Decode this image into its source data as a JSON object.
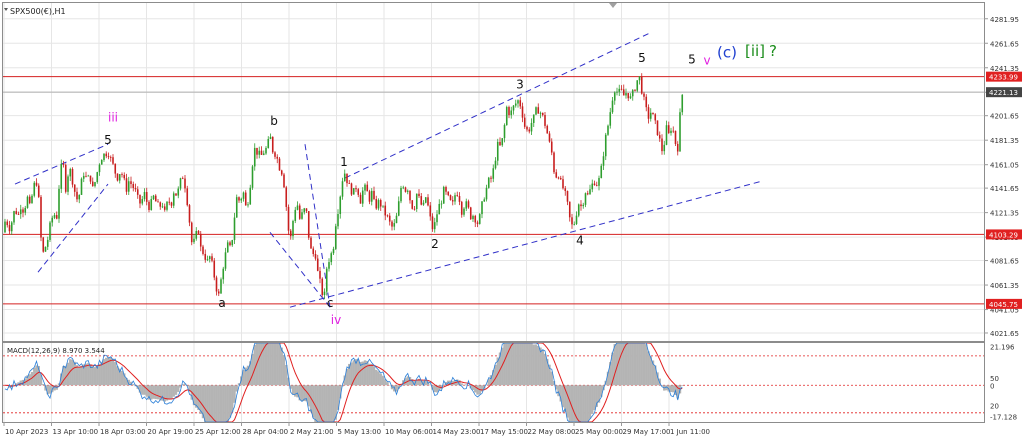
{
  "colors": {
    "up": "#2e9e2e",
    "down": "#c81e1e",
    "grid": "#e6e6e6",
    "hline": "#d42020",
    "channel": "#3030c8",
    "black": "#111111",
    "magenta": "#e020e0",
    "blue": "#2040d0",
    "green": "#1a8c1a",
    "axis": "#9a9a9a",
    "macd_fill": "#b4b4b4",
    "macd_signal": "#e02020",
    "macd_line": "#2a7fd8",
    "macd_level": "#e02020",
    "price_tag_red": "#e02020",
    "price_tag_dark": "#444444"
  },
  "chart_data": {
    "type": "candlestick",
    "title": "SPX500(€),H1",
    "ylim": [
      4015,
      4295
    ],
    "grid": true,
    "y_ticks": [
      "4281.95",
      "4261.65",
      "4241.35",
      "4221.05",
      "4201.65",
      "4181.35",
      "4161.05",
      "4141.65",
      "4121.35",
      "4101.05",
      "4081.65",
      "4061.35",
      "4041.05",
      "4021.65"
    ],
    "x_ticks": [
      "10 Apr 2023",
      "13 Apr 10:00",
      "18 Apr 03:00",
      "20 Apr 19:00",
      "25 Apr 12:00",
      "28 Apr 04:00",
      "2 May 21:00",
      "5 May 13:00",
      "10 May 06:00",
      "14 May 23:00",
      "17 May 15:00",
      "22 May 08:00",
      "25 May 00:00",
      "29 May 17:00",
      "1 Jun 11:00"
    ],
    "price_levels": [
      {
        "value": 4233.99,
        "label": "4233.99",
        "style": "red"
      },
      {
        "value": 4221.13,
        "label": "4221.13",
        "style": "current"
      },
      {
        "value": 4103.29,
        "label": "4103.29",
        "style": "red"
      },
      {
        "value": 4045.75,
        "label": "4045.75",
        "style": "red"
      }
    ],
    "path": [
      [
        0,
        4105
      ],
      [
        3,
        4112
      ],
      [
        6,
        4115
      ],
      [
        10,
        4108
      ],
      [
        13,
        4118
      ],
      [
        15,
        4125
      ],
      [
        18,
        4118
      ],
      [
        21,
        4128
      ],
      [
        24,
        4122
      ],
      [
        27,
        4135
      ],
      [
        30,
        4125
      ],
      [
        33,
        4140
      ],
      [
        36,
        4150
      ],
      [
        39,
        4130
      ],
      [
        42,
        4085
      ],
      [
        45,
        4092
      ],
      [
        48,
        4100
      ],
      [
        51,
        4115
      ],
      [
        54,
        4120
      ],
      [
        57,
        4118
      ],
      [
        60,
        4155
      ],
      [
        63,
        4163
      ],
      [
        66,
        4140
      ],
      [
        69,
        4160
      ],
      [
        72,
        4150
      ],
      [
        75,
        4138
      ],
      [
        78,
        4130
      ],
      [
        81,
        4145
      ],
      [
        84,
        4155
      ],
      [
        87,
        4148
      ],
      [
        90,
        4152
      ],
      [
        93,
        4140
      ],
      [
        96,
        4150
      ],
      [
        99,
        4162
      ],
      [
        102,
        4168
      ],
      [
        105,
        4170
      ],
      [
        108,
        4172
      ],
      [
        111,
        4165
      ],
      [
        114,
        4158
      ],
      [
        117,
        4150
      ],
      [
        120,
        4155
      ],
      [
        123,
        4152
      ],
      [
        126,
        4140
      ],
      [
        129,
        4148
      ],
      [
        132,
        4144
      ],
      [
        135,
        4140
      ],
      [
        138,
        4132
      ],
      [
        141,
        4128
      ],
      [
        144,
        4138
      ],
      [
        147,
        4130
      ],
      [
        150,
        4125
      ],
      [
        153,
        4135
      ],
      [
        156,
        4130
      ],
      [
        159,
        4125
      ],
      [
        162,
        4130
      ],
      [
        165,
        4120
      ],
      [
        168,
        4132
      ],
      [
        171,
        4128
      ],
      [
        174,
        4140
      ],
      [
        177,
        4135
      ],
      [
        180,
        4146
      ],
      [
        183,
        4152
      ],
      [
        186,
        4140
      ],
      [
        189,
        4118
      ],
      [
        192,
        4095
      ],
      [
        195,
        4098
      ],
      [
        198,
        4110
      ],
      [
        201,
        4090
      ],
      [
        204,
        4088
      ],
      [
        207,
        4080
      ],
      [
        210,
        4085
      ],
      [
        213,
        4075
      ],
      [
        216,
        4060
      ],
      [
        219,
        4052
      ],
      [
        222,
        4072
      ],
      [
        225,
        4085
      ],
      [
        228,
        4095
      ],
      [
        231,
        4090
      ],
      [
        234,
        4115
      ],
      [
        237,
        4135
      ],
      [
        240,
        4130
      ],
      [
        243,
        4140
      ],
      [
        246,
        4125
      ],
      [
        249,
        4135
      ],
      [
        252,
        4160
      ],
      [
        255,
        4175
      ],
      [
        258,
        4170
      ],
      [
        261,
        4168
      ],
      [
        264,
        4172
      ],
      [
        267,
        4175
      ],
      [
        270,
        4185
      ],
      [
        273,
        4172
      ],
      [
        276,
        4170
      ],
      [
        279,
        4160
      ],
      [
        282,
        4155
      ],
      [
        285,
        4140
      ],
      [
        288,
        4108
      ],
      [
        291,
        4100
      ],
      [
        294,
        4122
      ],
      [
        297,
        4130
      ],
      [
        300,
        4115
      ],
      [
        303,
        4122
      ],
      [
        306,
        4125
      ],
      [
        309,
        4100
      ],
      [
        312,
        4085
      ],
      [
        315,
        4090
      ],
      [
        318,
        4070
      ],
      [
        321,
        4060
      ],
      [
        324,
        4048
      ],
      [
        327,
        4078
      ],
      [
        330,
        4085
      ],
      [
        333,
        4090
      ],
      [
        336,
        4115
      ],
      [
        339,
        4128
      ],
      [
        342,
        4148
      ],
      [
        345,
        4155
      ],
      [
        348,
        4145
      ],
      [
        351,
        4140
      ],
      [
        354,
        4138
      ],
      [
        357,
        4145
      ],
      [
        360,
        4130
      ],
      [
        363,
        4140
      ],
      [
        366,
        4142
      ],
      [
        369,
        4132
      ],
      [
        372,
        4138
      ],
      [
        375,
        4125
      ],
      [
        378,
        4130
      ],
      [
        381,
        4128
      ],
      [
        384,
        4122
      ],
      [
        387,
        4118
      ],
      [
        390,
        4112
      ],
      [
        393,
        4108
      ],
      [
        396,
        4115
      ],
      [
        399,
        4130
      ],
      [
        402,
        4148
      ],
      [
        405,
        4140
      ],
      [
        408,
        4142
      ],
      [
        411,
        4128
      ],
      [
        414,
        4125
      ],
      [
        417,
        4138
      ],
      [
        420,
        4130
      ],
      [
        423,
        4125
      ],
      [
        426,
        4135
      ],
      [
        429,
        4122
      ],
      [
        432,
        4108
      ],
      [
        435,
        4112
      ],
      [
        438,
        4125
      ],
      [
        441,
        4130
      ],
      [
        444,
        4140
      ],
      [
        447,
        4135
      ],
      [
        450,
        4130
      ],
      [
        453,
        4128
      ],
      [
        456,
        4140
      ],
      [
        459,
        4135
      ],
      [
        462,
        4122
      ],
      [
        465,
        4130
      ],
      [
        468,
        4125
      ],
      [
        471,
        4118
      ],
      [
        474,
        4120
      ],
      [
        477,
        4112
      ],
      [
        480,
        4118
      ],
      [
        483,
        4132
      ],
      [
        486,
        4140
      ],
      [
        489,
        4148
      ],
      [
        492,
        4150
      ],
      [
        495,
        4165
      ],
      [
        498,
        4178
      ],
      [
        501,
        4175
      ],
      [
        504,
        4190
      ],
      [
        507,
        4210
      ],
      [
        510,
        4202
      ],
      [
        513,
        4208
      ],
      [
        516,
        4212
      ],
      [
        519,
        4215
      ],
      [
        522,
        4205
      ],
      [
        525,
        4192
      ],
      [
        528,
        4188
      ],
      [
        531,
        4195
      ],
      [
        534,
        4200
      ],
      [
        537,
        4208
      ],
      [
        540,
        4205
      ],
      [
        543,
        4200
      ],
      [
        546,
        4192
      ],
      [
        549,
        4180
      ],
      [
        552,
        4170
      ],
      [
        555,
        4150
      ],
      [
        558,
        4155
      ],
      [
        561,
        4145
      ],
      [
        564,
        4140
      ],
      [
        567,
        4130
      ],
      [
        570,
        4115
      ],
      [
        573,
        4108
      ],
      [
        576,
        4120
      ],
      [
        579,
        4130
      ],
      [
        582,
        4125
      ],
      [
        585,
        4140
      ],
      [
        588,
        4135
      ],
      [
        591,
        4142
      ],
      [
        594,
        4148
      ],
      [
        597,
        4145
      ],
      [
        600,
        4150
      ],
      [
        603,
        4168
      ],
      [
        606,
        4185
      ],
      [
        609,
        4198
      ],
      [
        612,
        4215
      ],
      [
        615,
        4225
      ],
      [
        618,
        4220
      ],
      [
        621,
        4222
      ],
      [
        624,
        4218
      ],
      [
        627,
        4222
      ],
      [
        630,
        4215
      ],
      [
        633,
        4220
      ],
      [
        636,
        4228
      ],
      [
        639,
        4235
      ],
      [
        642,
        4222
      ],
      [
        645,
        4210
      ],
      [
        648,
        4200
      ],
      [
        651,
        4205
      ],
      [
        654,
        4198
      ],
      [
        657,
        4190
      ],
      [
        660,
        4180
      ],
      [
        663,
        4170
      ],
      [
        666,
        4192
      ],
      [
        669,
        4185
      ],
      [
        672,
        4195
      ],
      [
        675,
        4180
      ],
      [
        678,
        4175
      ],
      [
        681,
        4215
      ],
      [
        684,
        4225
      ]
    ],
    "waves": [
      {
        "text": "iii",
        "color": "magenta",
        "x": 113,
        "y": 4197
      },
      {
        "text": "5",
        "color": "black",
        "x": 108,
        "y": 4178
      },
      {
        "text": "a",
        "color": "black",
        "x": 222,
        "y": 4043
      },
      {
        "text": "b",
        "color": "black",
        "x": 274,
        "y": 4194
      },
      {
        "text": "c",
        "color": "black",
        "x": 330,
        "y": 4043
      },
      {
        "text": "iv",
        "color": "magenta",
        "x": 336,
        "y": 4029
      },
      {
        "text": "1",
        "color": "black",
        "x": 344,
        "y": 4160
      },
      {
        "text": "2",
        "color": "black",
        "x": 435,
        "y": 4092
      },
      {
        "text": "3",
        "color": "black",
        "x": 520,
        "y": 4224
      },
      {
        "text": "4",
        "color": "black",
        "x": 580,
        "y": 4095
      },
      {
        "text": "5",
        "color": "black",
        "x": 642,
        "y": 4246
      },
      {
        "text": "5",
        "color": "black",
        "x": 692,
        "y": 4245
      },
      {
        "text": "v",
        "color": "magenta",
        "x": 707,
        "y": 4244
      },
      {
        "text": "(c)",
        "color": "blue",
        "x": 727,
        "y": 4250
      },
      {
        "text": "[ii]",
        "color": "green",
        "x": 755,
        "y": 4251
      },
      {
        "text": "?",
        "color": "green",
        "x": 773,
        "y": 4251
      }
    ],
    "trendlines": [
      [
        [
          15,
          4145
        ],
        [
          108,
          4178
        ]
      ],
      [
        [
          38,
          4072
        ],
        [
          108,
          4145
        ]
      ],
      [
        [
          290,
          4043
        ],
        [
          760,
          4147
        ]
      ],
      [
        [
          345,
          4150
        ],
        [
          652,
          4271
        ]
      ],
      [
        [
          270,
          4105
        ],
        [
          330,
          4043
        ]
      ],
      [
        [
          305,
          4178
        ],
        [
          330,
          4043
        ]
      ]
    ],
    "macd": {
      "label": "MACD(12,26,9) 8.970 3.544",
      "ylim": [
        -20,
        23
      ],
      "y_ticks": [
        "21.196",
        "0",
        "-17.128"
      ],
      "level_labels": [
        "50",
        "20"
      ],
      "levels": [
        16,
        0,
        -15
      ]
    }
  }
}
